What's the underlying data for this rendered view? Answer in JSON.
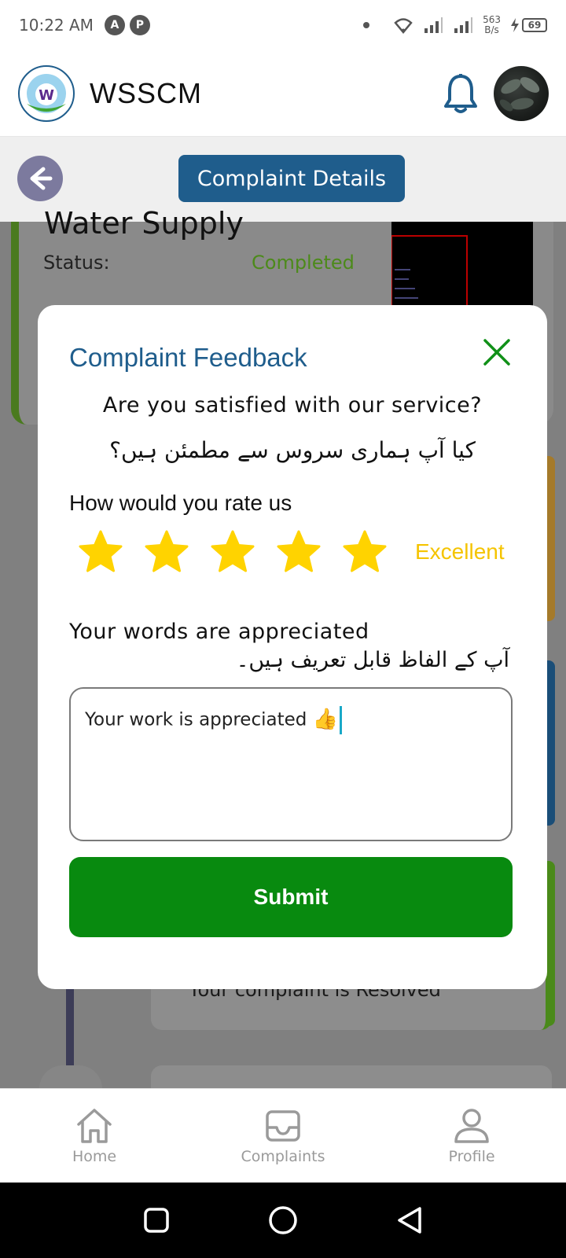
{
  "status_bar": {
    "time": "10:22 AM",
    "app_icons": [
      "A",
      "P"
    ],
    "speed_value": "563",
    "speed_unit": "B/s",
    "battery": "69"
  },
  "header": {
    "app_title": "WSSCM",
    "logo_letter": "W"
  },
  "subheader": {
    "page_title": "Complaint Details"
  },
  "background_card": {
    "title": "Water Supply",
    "status_label": "Status:",
    "status_value": "Completed",
    "resolved_text": "Your complaint is Resolved"
  },
  "modal": {
    "title": "Complaint Feedback",
    "question_en": "Are you satisfied with our service?",
    "question_ur": "کیا آپ ہماری سروس سے مطمئن ہیں؟",
    "rate_label": "How would you rate us",
    "rating": 5,
    "rating_max": 5,
    "rating_text": "Excellent",
    "words_en": "Your words are appreciated",
    "words_ur": "آپ کے الفاظ قابل تعریف ہیں۔",
    "feedback_value": "Your work is appreciated",
    "feedback_emoji": "👍",
    "submit_label": "Submit"
  },
  "bottom_nav": {
    "items": [
      {
        "label": "Home",
        "icon": "home-icon"
      },
      {
        "label": "Complaints",
        "icon": "inbox-icon"
      },
      {
        "label": "Profile",
        "icon": "person-icon"
      }
    ]
  },
  "colors": {
    "primary": "#1f5d8c",
    "success": "#088a0f",
    "star": "#f5c400",
    "back_button": "#7c7a9e"
  }
}
